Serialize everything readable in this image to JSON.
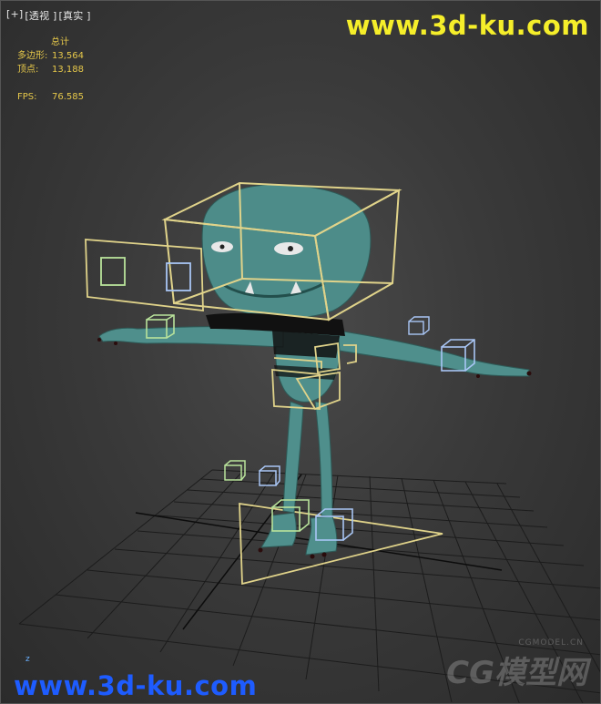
{
  "viewport": {
    "menu_plus": "[+]",
    "menu_view": "[透视 ]",
    "menu_shading": "[真实 ]"
  },
  "stats": {
    "title": "总计",
    "polygons_label": "多边形:",
    "polygons_value": "13,564",
    "vertices_label": "顶点:",
    "vertices_value": "13,188",
    "fps_label": "FPS:",
    "fps_value": "76.585"
  },
  "watermarks": {
    "top": "www.3d-ku.com",
    "bottom": "www.3d-ku.com",
    "cg_small": "CGMODEL.CN",
    "cg_big": "CG模型网"
  },
  "axis": {
    "z_label": "z"
  },
  "colors": {
    "character": "#4f8f8c",
    "bone_yellow": "#e0d38a",
    "bone_green": "#b9e39b",
    "bone_blue": "#a9c6f5",
    "grid": "#1a1a1a"
  }
}
